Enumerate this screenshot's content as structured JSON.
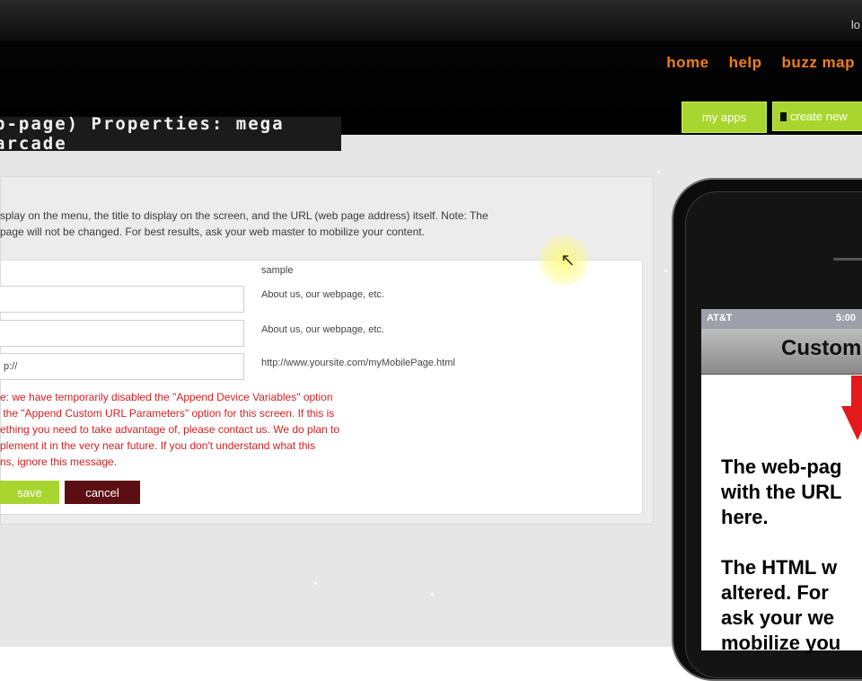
{
  "header": {
    "top_right_text": "lo",
    "nav": [
      "home",
      "help",
      "buzz map"
    ],
    "my_apps_label": "my apps",
    "create_new_label": "create new",
    "title": "b-page) Properties: mega arcade"
  },
  "panel": {
    "intro_line1": "splay on the menu, the title to display on the screen, and the URL (web page address) itself. Note: The",
    "intro_line2": "page will not be changed. For best results, ask your web master to mobilize your content.",
    "sample_header": "sample",
    "fields": [
      {
        "value": "",
        "hint": "About us, our webpage, etc."
      },
      {
        "value": "",
        "hint": "About us, our webpage, etc."
      },
      {
        "value": "p://",
        "hint": "http://www.yoursite.com/myMobilePage.html"
      }
    ],
    "warning": "e: we have temporarily disabled the \"Append Device Variables\" option\n the \"Append Custom URL Parameters\" option for this screen. If this is\nething you need to take advantage of, please contact us. We do plan to\nplement it in the very near future. If you don't understand what this\nns, ignore this message.",
    "save_label": "save",
    "cancel_label": "cancel"
  },
  "phone": {
    "carrier": "AT&T",
    "time": "5:00",
    "app_title": "Custom",
    "body_text": "The web-pag\nwith the URL\nhere.\n\nThe HTML w\naltered. For \nask your we\nmobilize you"
  },
  "colors": {
    "nav_orange": "#f07f17",
    "button_green": "#a9d62e",
    "cancel_maroon": "#5b0f12",
    "warning_red": "#d62020",
    "arrow_red": "#e21a1a"
  }
}
